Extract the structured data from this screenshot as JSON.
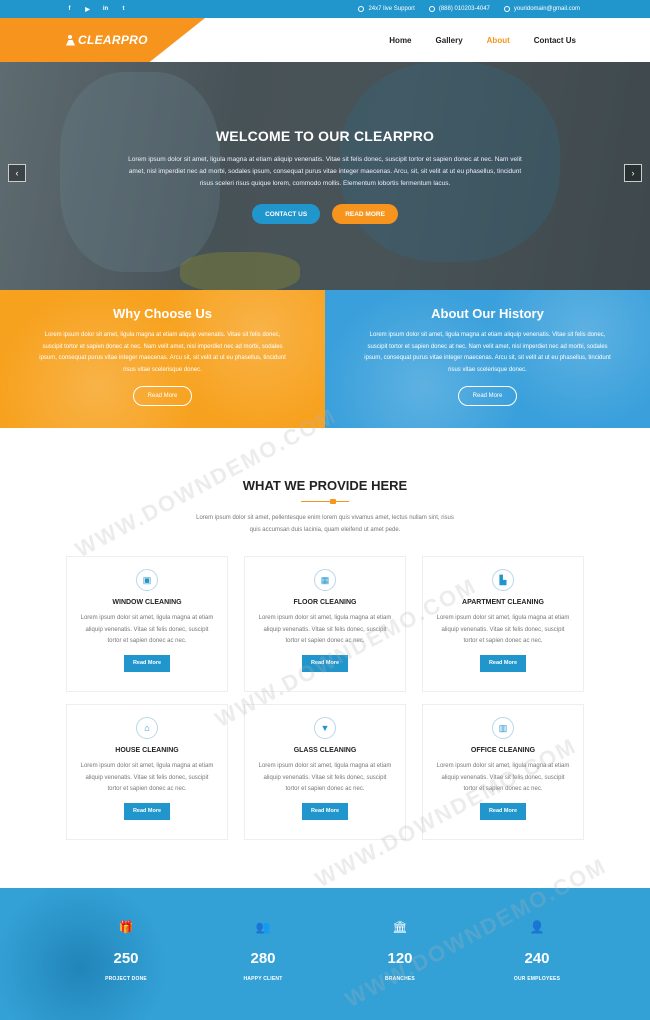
{
  "topbar": {
    "social": [
      "f",
      "▶",
      "in",
      "t"
    ],
    "support": "24x7 live Support",
    "phone": "(888) 010203-4047",
    "email": "youridomain@gmail.com"
  },
  "header": {
    "logo": "CLEARPRO",
    "nav": [
      "Home",
      "Gallery",
      "About",
      "Contact Us"
    ],
    "active_nav": "About"
  },
  "hero": {
    "title": "WELCOME TO OUR CLEARPRO",
    "text": "Lorem ipsum dolor sit amet, ligula magna at etiam aliquip venenatis. Vitae sit felis donec, suscipit tortor et sapien donec at nec. Nam velit amet, nisl imperdiet nec ad morbi, sodales ipsum, consequat purus vitae integer maecenas. Arcu, sit, sit velit at ut eu phasellus, tincidunt risus sceleri risus quique lorem, commodo mollis. Elementum lobortis fermentum lacus.",
    "btn_contact": "CONTACT US",
    "btn_more": "READ MORE",
    "prev_arrow": "‹",
    "next_arrow": "›"
  },
  "panels": {
    "left": {
      "title": "Why Choose Us",
      "text": "Lorem ipsum dolor sit amet, ligula magna at etiam aliquip venenatis. Vitae sit felis donec, suscipit tortor et sapien donec at nec. Nam velit amet, nisl imperdiet nec ad morbi, sodales ipsum, consequat purus vitae integer maecenas. Arcu sit, sit velit at ut eu phasellus, tincidunt risus vitae scelerisque donec.",
      "btn": "Read More"
    },
    "right": {
      "title": "About Our History",
      "text": "Lorem ipsum dolor sit amet, ligula magna at etiam aliquip venenatis. Vitae sit felis donec, suscipit tortor et sapien donec at nec. Nam velit amet, nisl imperdiet nec ad morbi, sodales ipsum, consequat purus vitae integer maecenas. Arcu sit, sit velit at ut eu phasellus, tincidunt risus vitae scelerisque donec.",
      "btn": "Read More"
    }
  },
  "provide": {
    "title": "WHAT WE PROVIDE HERE",
    "intro": "Lorem ipsum dolor sit amet, pellentesque enim lorem quis vivamus amet, lectus nullam sint, risus quis accumsan duis lacinia, quam eleifend ut amet pede.",
    "card_text": "Lorem ipsum dolor sit amet, ligula magna at etiam aliquip venenatis. Vitae sit felis donec, suscipit tortor et sapien donec ac nec.",
    "card_btn": "Read More",
    "services": [
      {
        "title": "WINDOW CLEANING",
        "icon": "▣"
      },
      {
        "title": "FLOOR CLEANING",
        "icon": "▦"
      },
      {
        "title": "APARTMENT CLEANING",
        "icon": "▙"
      },
      {
        "title": "HOUSE CLEANING",
        "icon": "⌂"
      },
      {
        "title": "GLASS CLEANING",
        "icon": "▼"
      },
      {
        "title": "OFFICE CLEANING",
        "icon": "▥"
      }
    ]
  },
  "stats": [
    {
      "num": "250",
      "label": "PROJECT DONE",
      "icon": "🎁"
    },
    {
      "num": "280",
      "label": "HAPPY CLIENT",
      "icon": "👥"
    },
    {
      "num": "120",
      "label": "BRANCHES",
      "icon": "🏛"
    },
    {
      "num": "240",
      "label": "OUR EMPLOYEES",
      "icon": "👤"
    }
  ],
  "watermark": "WWW.DOWNDEMO.COM"
}
